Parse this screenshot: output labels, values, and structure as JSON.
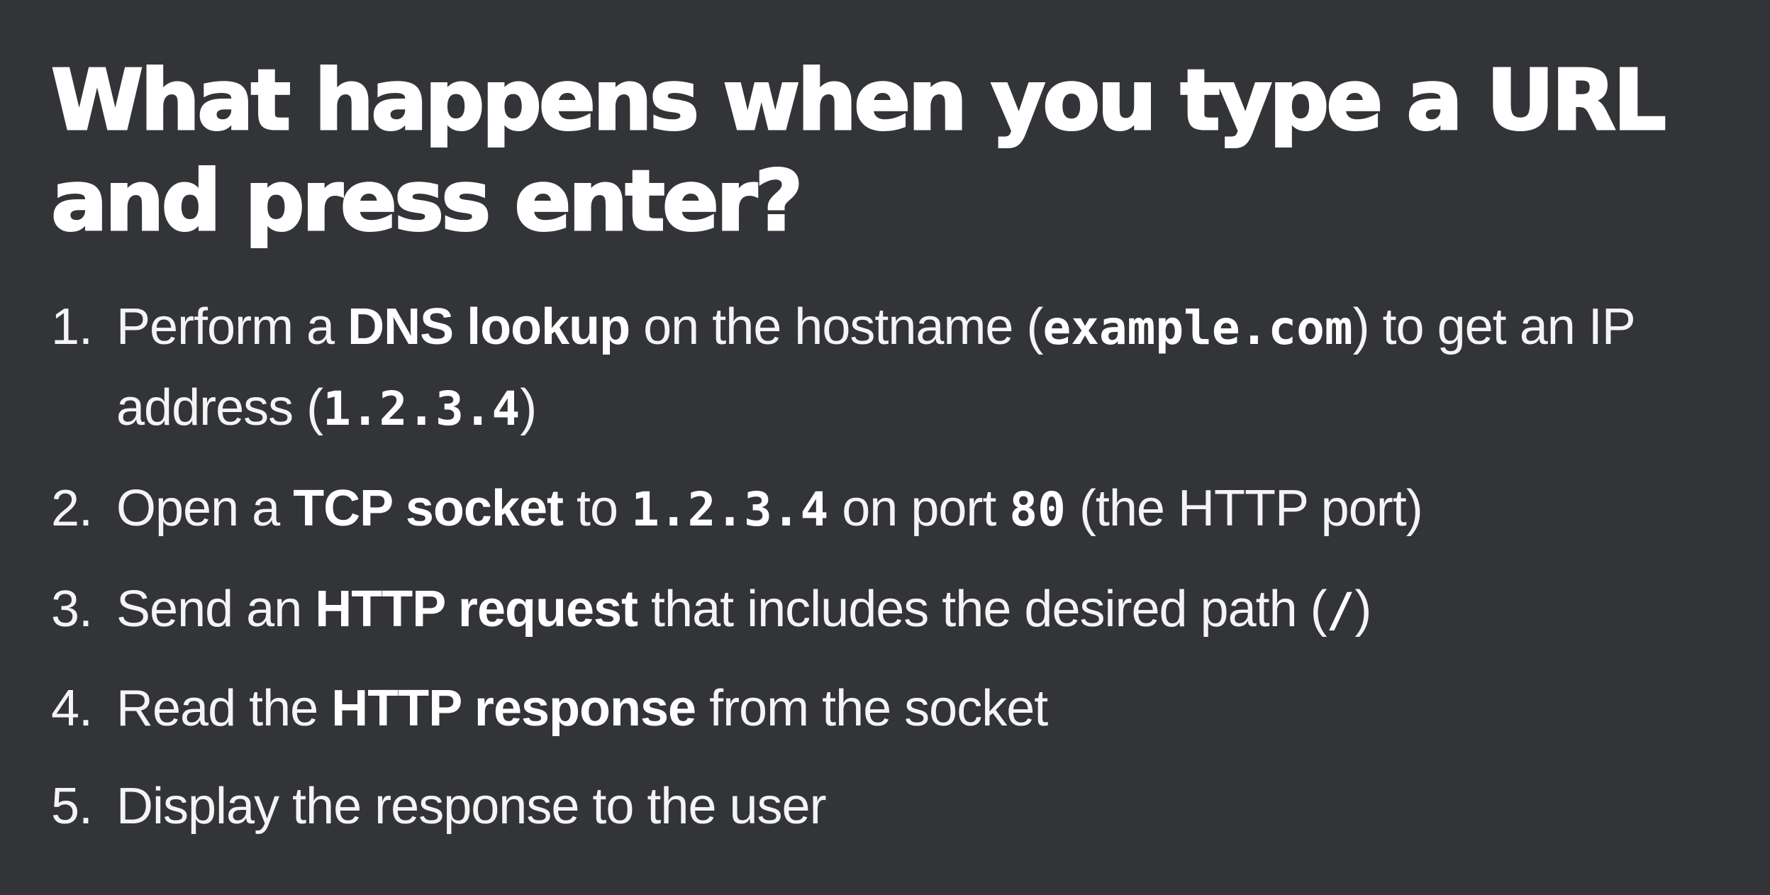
{
  "slide": {
    "title": "What happens when you type a URL and press enter?",
    "steps": [
      {
        "number": "1.",
        "t1": "Perform a ",
        "b1": "DNS lookup",
        "t2": " on the hostname (",
        "c1": "example.com",
        "t3": ") to get an IP address (",
        "c2": "1.2.3.4",
        "t4": ")"
      },
      {
        "number": "2.",
        "t1": "Open a ",
        "b1": "TCP socket",
        "t2": " to ",
        "c1": "1.2.3.4",
        "t3": " on port ",
        "c2": "80",
        "t4": " (the HTTP port)"
      },
      {
        "number": "3.",
        "t1": "Send an ",
        "b1": "HTTP request",
        "t2": " that includes the desired path (",
        "c1": "/",
        "t3": ")"
      },
      {
        "number": "4.",
        "t1": "Read the ",
        "b1": "HTTP response",
        "t2": " from the socket"
      },
      {
        "number": "5.",
        "t1": "Display the response to the user"
      }
    ]
  }
}
